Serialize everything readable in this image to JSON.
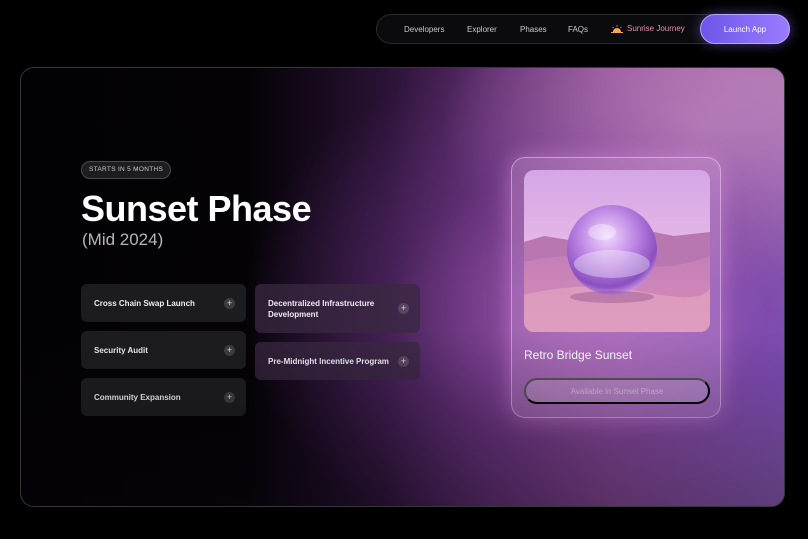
{
  "nav": {
    "links": [
      "Developers",
      "Explorer",
      "Phases",
      "FAQs"
    ],
    "journey_label": "Sunrise Journey",
    "launch_label": "Launch App"
  },
  "hero": {
    "badge": "STARTS IN 5 MONTHS",
    "title": "Sunset Phase",
    "subtitle": "(Mid 2024)",
    "items_left": [
      "Cross Chain Swap Launch",
      "Security Audit",
      "Community Expansion"
    ],
    "items_right": [
      "Decentralized Infrastructure Development",
      "Pre-Midnight Incentive Program"
    ]
  },
  "nft": {
    "name": "Retro Bridge Sunset",
    "button_label": "Available in Sunset Phase"
  },
  "colors": {
    "accent": "#8b6cf5",
    "journey": "#e98fb7"
  }
}
